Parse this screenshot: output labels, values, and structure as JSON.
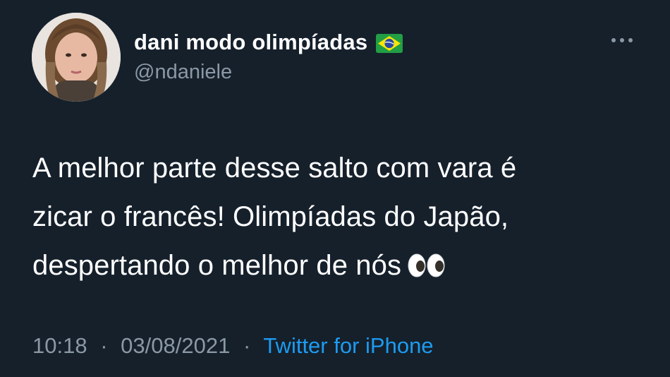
{
  "author": {
    "display_name": "dani modo olimpíadas",
    "flag_icon": "brazil-flag-icon",
    "handle": "@ndaniele",
    "avatar_icon": "profile-photo"
  },
  "menu": {
    "more_icon": "more-horizontal-icon"
  },
  "tweet": {
    "lines": [
      "A melhor parte desse salto com vara é",
      "zicar o francês! Olimpíadas do Japão,",
      "despertando o melhor de nós"
    ],
    "emoji_icon": "eyes-emoji-icon"
  },
  "meta": {
    "time": "10:18",
    "date": "03/08/2021",
    "separator": "·",
    "source": "Twitter for iPhone"
  },
  "colors": {
    "background": "#15202b",
    "text_primary": "#ffffff",
    "text_secondary": "#8b98a5",
    "link": "#1d9bf0"
  }
}
